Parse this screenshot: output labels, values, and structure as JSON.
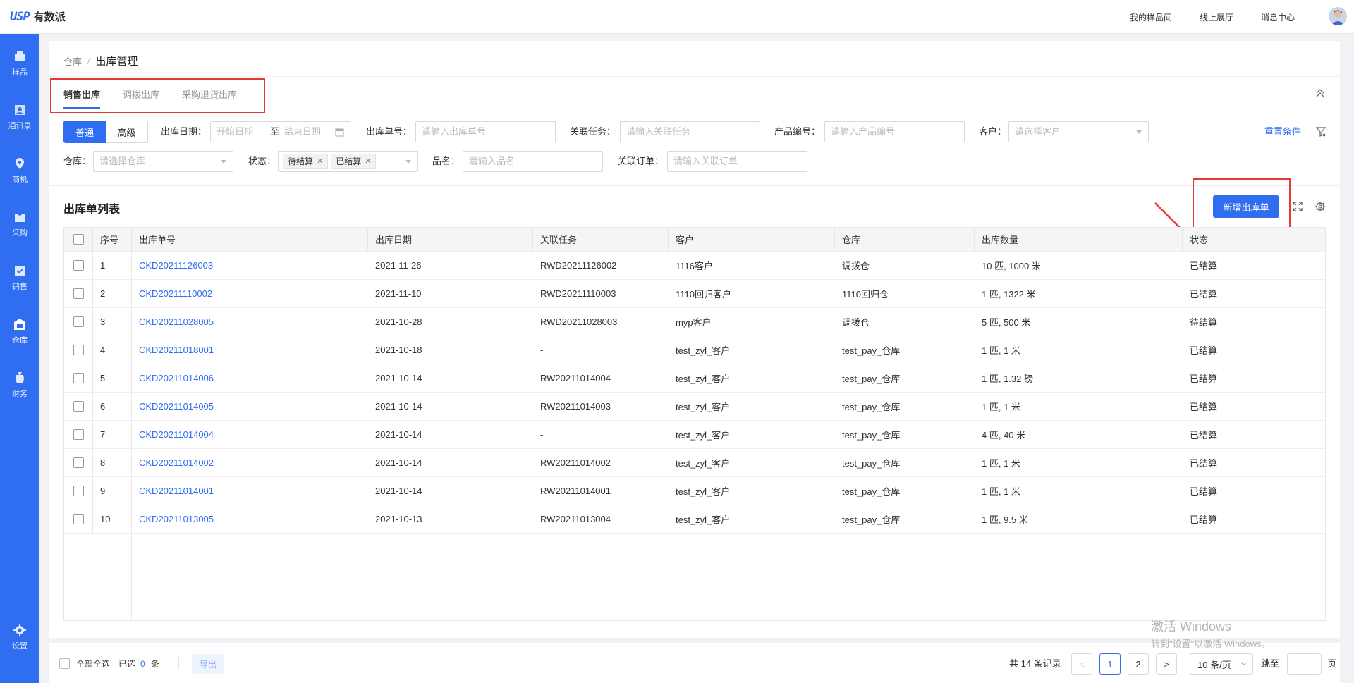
{
  "app": {
    "logo_mark": "USP",
    "logo_text": "有数派"
  },
  "top_links": [
    "我的样品间",
    "线上展厅",
    "消息中心"
  ],
  "sidebar": [
    {
      "label": "样品",
      "icon": "sample-icon"
    },
    {
      "label": "通讯录",
      "icon": "contacts-icon"
    },
    {
      "label": "商机",
      "icon": "opportunity-icon"
    },
    {
      "label": "采购",
      "icon": "purchase-icon"
    },
    {
      "label": "销售",
      "icon": "sales-icon"
    },
    {
      "label": "仓库",
      "icon": "warehouse-icon"
    },
    {
      "label": "财务",
      "icon": "finance-icon"
    },
    {
      "label": "设置",
      "icon": "settings-icon"
    }
  ],
  "breadcrumb": {
    "parent": "仓库",
    "sep": "/",
    "current": "出库管理"
  },
  "tabs": [
    "销售出库",
    "调拨出库",
    "采购退货出库"
  ],
  "filters": {
    "mode_normal": "普通",
    "mode_advanced": "高级",
    "date_label": "出库日期：",
    "date_start": "开始日期",
    "date_to": "至",
    "date_end": "结束日期",
    "order_no_label": "出库单号：",
    "order_no_ph": "请输入出库单号",
    "task_label": "关联任务：",
    "task_ph": "请输入关联任务",
    "product_label": "产品编号：",
    "product_ph": "请输入产品编号",
    "customer_label": "客户：",
    "customer_ph": "请选择客户",
    "reset": "重置条件",
    "warehouse_label": "仓库：",
    "warehouse_ph": "请选择仓库",
    "status_label": "状态：",
    "status_tags": [
      "待结算",
      "已结算"
    ],
    "name_label": "品名：",
    "name_ph": "请输入品名",
    "linked_order_label": "关联订单：",
    "linked_order_ph": "请输入关联订单"
  },
  "list": {
    "title": "出库单列表",
    "new_button": "新增出库单",
    "columns": [
      "序号",
      "出库单号",
      "出库日期",
      "关联任务",
      "客户",
      "仓库",
      "出库数量",
      "状态"
    ],
    "rows": [
      [
        "1",
        "CKD20211126003",
        "2021-11-26",
        "RWD20211126002",
        "1116客户",
        "调拨仓",
        "10 匹, 1000 米",
        "已结算"
      ],
      [
        "2",
        "CKD20211110002",
        "2021-11-10",
        "RWD20211110003",
        "1110回归客户",
        "1110回归仓",
        "1 匹, 1322 米",
        "已结算"
      ],
      [
        "3",
        "CKD20211028005",
        "2021-10-28",
        "RWD20211028003",
        "myp客户",
        "调拨仓",
        "5 匹, 500 米",
        "待结算"
      ],
      [
        "4",
        "CKD20211018001",
        "2021-10-18",
        "-",
        "test_zyl_客户",
        "test_pay_仓库",
        "1 匹, 1 米",
        "已结算"
      ],
      [
        "5",
        "CKD20211014006",
        "2021-10-14",
        "RW20211014004",
        "test_zyl_客户",
        "test_pay_仓库",
        "1 匹, 1.32 磅",
        "已结算"
      ],
      [
        "6",
        "CKD20211014005",
        "2021-10-14",
        "RW20211014003",
        "test_zyl_客户",
        "test_pay_仓库",
        "1 匹, 1 米",
        "已结算"
      ],
      [
        "7",
        "CKD20211014004",
        "2021-10-14",
        "-",
        "test_zyl_客户",
        "test_pay_仓库",
        "4 匹, 40 米",
        "已结算"
      ],
      [
        "8",
        "CKD20211014002",
        "2021-10-14",
        "RW20211014002",
        "test_zyl_客户",
        "test_pay_仓库",
        "1 匹, 1 米",
        "已结算"
      ],
      [
        "9",
        "CKD20211014001",
        "2021-10-14",
        "RW20211014001",
        "test_zyl_客户",
        "test_pay_仓库",
        "1 匹, 1 米",
        "已结算"
      ],
      [
        "10",
        "CKD20211013005",
        "2021-10-13",
        "RW20211013004",
        "test_zyl_客户",
        "test_pay_仓库",
        "1 匹, 9.5 米",
        "已结算"
      ]
    ]
  },
  "footer": {
    "select_all": "全部全选",
    "selected_prefix": "已选",
    "selected_count": "0",
    "selected_suffix": "条",
    "export": "导出",
    "total_text": "共 14 条记录",
    "pages": [
      "1",
      "2"
    ],
    "current_page": "1",
    "page_size": "10 条/页",
    "jump_label": "跳至",
    "page_unit": "页"
  },
  "watermark": {
    "line1": "激活 Windows",
    "line2": "转到\"设置\"以激活 Windows。"
  },
  "colors": {
    "primary": "#2f6ef0",
    "annotation": "#e53935"
  }
}
